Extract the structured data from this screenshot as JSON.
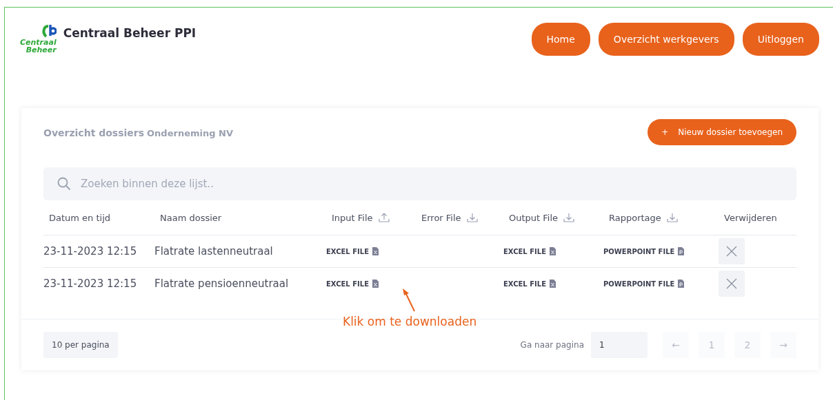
{
  "header": {
    "logo_text": [
      "Centraal",
      "Beheer"
    ],
    "title": "Centraal Beheer PPI",
    "nav": [
      "Home",
      "Overzicht werkgevers",
      "Uitloggen"
    ]
  },
  "card": {
    "title": "Overzicht dossiers",
    "subtitle": "Onderneming NV",
    "add_button": "Nieuw dossier toevoegen",
    "add_icon": "+",
    "search": {
      "placeholder": "Zoeken binnen deze lijst.."
    },
    "columns": [
      {
        "label": "Datum en tijd",
        "kind": "plain"
      },
      {
        "label": "Naam dossier",
        "kind": "plain"
      },
      {
        "label": "Input File",
        "kind": "upload"
      },
      {
        "label": "Error File",
        "kind": "download"
      },
      {
        "label": "Output File",
        "kind": "download"
      },
      {
        "label": "Rapportage",
        "kind": "download"
      },
      {
        "label": "Verwijderen",
        "kind": "plain"
      }
    ],
    "rows": [
      {
        "date": "23-11-2023 12:15",
        "name": "Flatrate lastenneutraal",
        "input": "EXCEL FILE",
        "output": "EXCEL FILE",
        "report": "POWERPOINT FILE"
      },
      {
        "date": "23-11-2023 12:15",
        "name": "Flatrate pensioenneutraal",
        "input": "EXCEL FILE",
        "output": "EXCEL FILE",
        "report": "POWERPOINT FILE"
      }
    ],
    "annotation": "Klik om te downloaden",
    "footer": {
      "per_page": "10 per pagina",
      "goto_label": "Ga naar pagina",
      "goto_value": "1",
      "prev": "←",
      "pages": [
        "1",
        "2"
      ],
      "next": "→"
    }
  }
}
